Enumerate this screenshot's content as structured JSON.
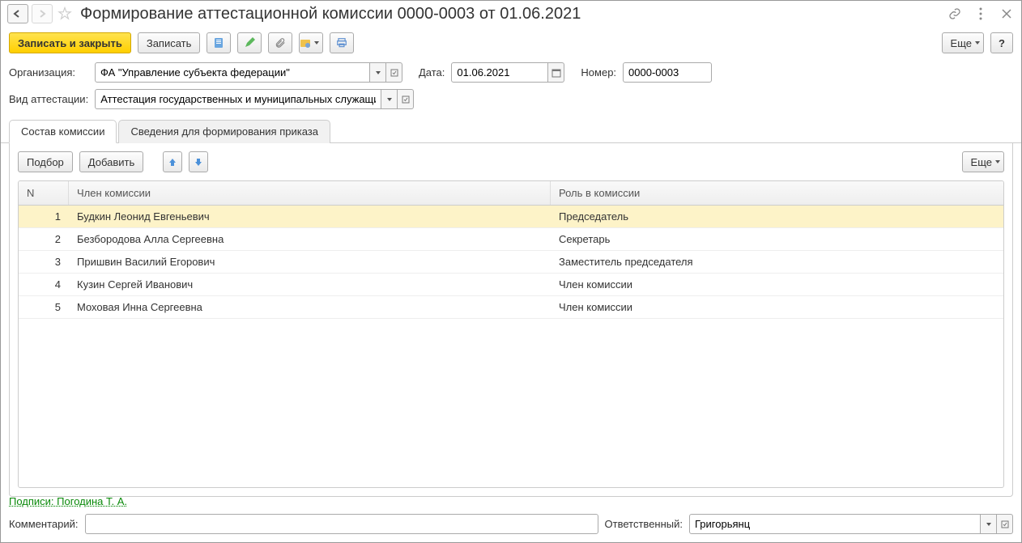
{
  "title": "Формирование аттестационной комиссии 0000-0003 от 01.06.2021",
  "toolbar": {
    "save_close": "Записать и закрыть",
    "save": "Записать",
    "more": "Еще"
  },
  "form": {
    "org_label": "Организация:",
    "org_value": "ФА \"Управление субъекта федерации\"",
    "date_label": "Дата:",
    "date_value": "01.06.2021",
    "num_label": "Номер:",
    "num_value": "0000-0003",
    "type_label": "Вид аттестации:",
    "type_value": "Аттестация государственных и муниципальных служащих"
  },
  "tabs": {
    "composition": "Состав комиссии",
    "order_info": "Сведения для формирования приказа"
  },
  "pane": {
    "pick": "Подбор",
    "add": "Добавить",
    "more": "Еще"
  },
  "table": {
    "col_n": "N",
    "col_member": "Член комиссии",
    "col_role": "Роль в комиссии",
    "rows": [
      {
        "n": "1",
        "member": "Будкин Леонид Евгеньевич",
        "role": "Председатель"
      },
      {
        "n": "2",
        "member": "Безбородова Алла Сергеевна",
        "role": "Секретарь"
      },
      {
        "n": "3",
        "member": "Пришвин Василий Егорович",
        "role": "Заместитель председателя"
      },
      {
        "n": "4",
        "member": "Кузин Сергей Иванович",
        "role": "Член комиссии"
      },
      {
        "n": "5",
        "member": "Моховая Инна Сергеевна",
        "role": "Член комиссии"
      }
    ]
  },
  "footer": {
    "sign": "Подписи: Погодина Т. А.",
    "comment_label": "Комментарий:",
    "resp_label": "Ответственный:",
    "resp_value": "Григорьянц"
  },
  "help": "?"
}
